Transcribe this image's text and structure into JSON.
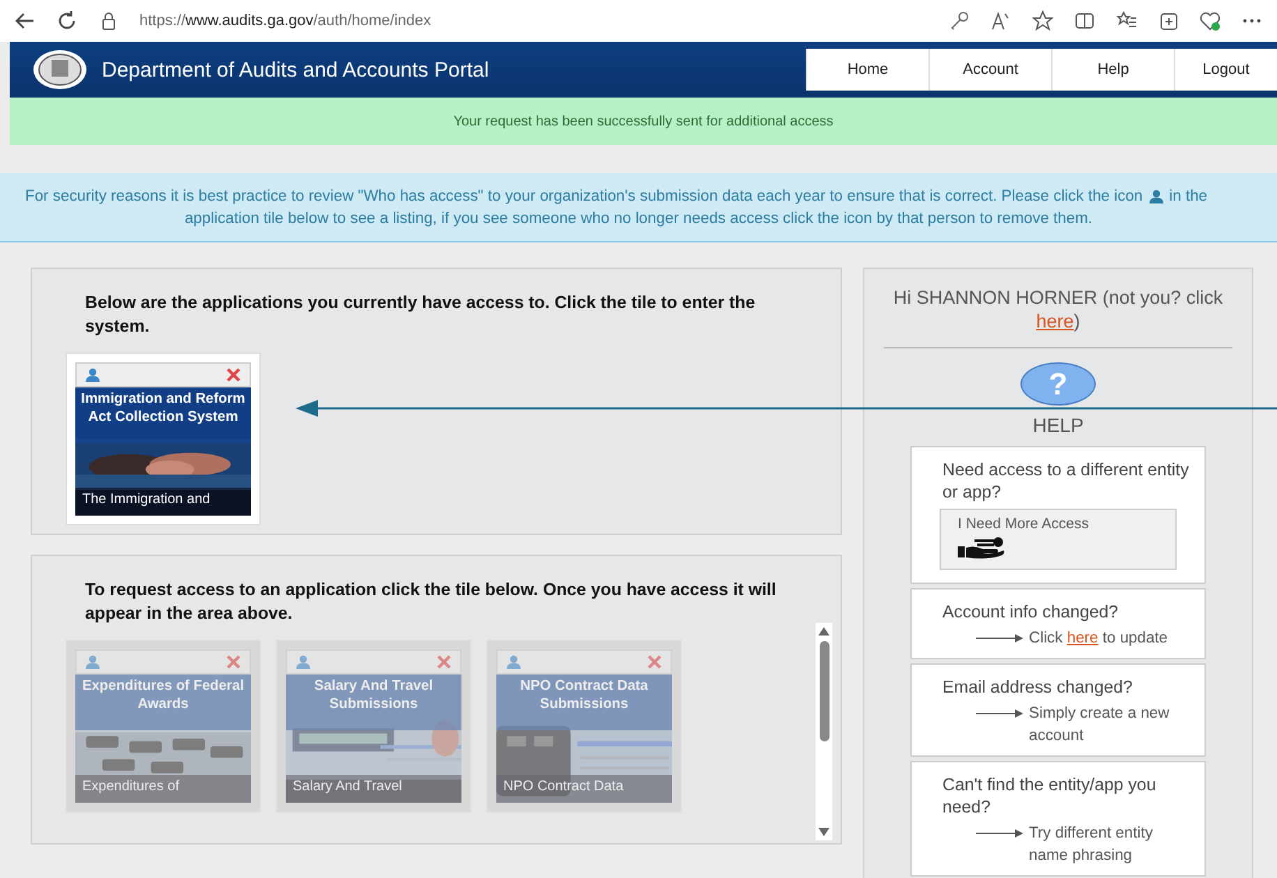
{
  "browser": {
    "url": "https://**www.audits.ga.gov**/auth/home/index"
  },
  "header": {
    "title": "Department of Audits and Accounts Portal",
    "nav": [
      {
        "label": "Home"
      },
      {
        "label": "Account"
      },
      {
        "label": "Help"
      },
      {
        "label": "Logout"
      }
    ]
  },
  "success_message": "Your request has been successfully sent for additional access",
  "info_message": {
    "before_icon": "For security reasons it is best practice to review \"Who has access\" to your organization's submission data each year to ensure that is correct. Please click the icon",
    "after_icon": "in the",
    "second_line": "application tile below to see a listing, if you see someone who no longer needs access click the icon by that person to remove them."
  },
  "current_apps": {
    "heading": "Below are the applications you currently have access to. Click the tile to enter the system.",
    "tiles": [
      {
        "title": "Immigration and Reform Act Collection System",
        "caption": "The Immigration and",
        "dimmed": false
      }
    ]
  },
  "request_apps": {
    "heading": "To request access to an application click the tile below. Once you have access it will appear in the area above.",
    "tiles": [
      {
        "title": "Expenditures of Federal Awards",
        "caption": "Expenditures of",
        "dimmed": true
      },
      {
        "title": "Salary And Travel Submissions",
        "caption": "Salary And Travel",
        "dimmed": true
      },
      {
        "title": "NPO Contract Data Submissions",
        "caption": "NPO Contract Data",
        "dimmed": true
      }
    ]
  },
  "sidebar": {
    "greeting": "Hi SHANNON HORNER (not you? click",
    "greeting_link": "here",
    "greeting_end": ")",
    "help_icon": "?",
    "help_label": "HELP",
    "cards": [
      {
        "kind": "button",
        "question": "Need access to a different entity or app?",
        "button_label": "I Need More Access"
      },
      {
        "kind": "link",
        "question": "Account info changed?",
        "before": "Click",
        "link": "here",
        "after": "to update"
      },
      {
        "kind": "text",
        "question": "Email address changed?",
        "answer": "Simply create a new account"
      },
      {
        "kind": "text",
        "question": "Can't find the entity/app you need?",
        "answer": "Try different entity name phrasing"
      }
    ]
  }
}
